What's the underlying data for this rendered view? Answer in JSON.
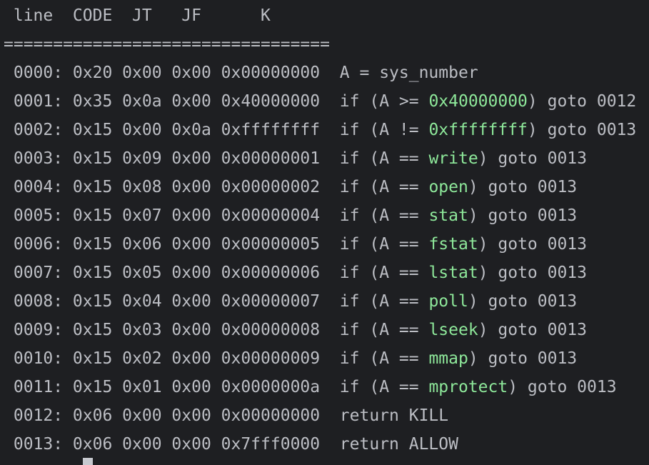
{
  "colors": {
    "background": "#1e1f22",
    "foreground": "#bcbec4",
    "highlight": "#8ee89a",
    "cursor": "#c7c9cf"
  },
  "header": " line  CODE  JT   JF      K",
  "separator": "=================================",
  "rows": [
    {
      "prefix": " 0000: 0x20 0x00 0x00 0x00000000  A = sys_number",
      "highlight": "",
      "suffix": ""
    },
    {
      "prefix": " 0001: 0x35 0x0a 0x00 0x40000000  if (A >= ",
      "highlight": "0x40000000",
      "suffix": ") goto 0012"
    },
    {
      "prefix": " 0002: 0x15 0x00 0x0a 0xffffffff  if (A != ",
      "highlight": "0xffffffff",
      "suffix": ") goto 0013"
    },
    {
      "prefix": " 0003: 0x15 0x09 0x00 0x00000001  if (A == ",
      "highlight": "write",
      "suffix": ") goto 0013"
    },
    {
      "prefix": " 0004: 0x15 0x08 0x00 0x00000002  if (A == ",
      "highlight": "open",
      "suffix": ") goto 0013"
    },
    {
      "prefix": " 0005: 0x15 0x07 0x00 0x00000004  if (A == ",
      "highlight": "stat",
      "suffix": ") goto 0013"
    },
    {
      "prefix": " 0006: 0x15 0x06 0x00 0x00000005  if (A == ",
      "highlight": "fstat",
      "suffix": ") goto 0013"
    },
    {
      "prefix": " 0007: 0x15 0x05 0x00 0x00000006  if (A == ",
      "highlight": "lstat",
      "suffix": ") goto 0013"
    },
    {
      "prefix": " 0008: 0x15 0x04 0x00 0x00000007  if (A == ",
      "highlight": "poll",
      "suffix": ") goto 0013"
    },
    {
      "prefix": " 0009: 0x15 0x03 0x00 0x00000008  if (A == ",
      "highlight": "lseek",
      "suffix": ") goto 0013"
    },
    {
      "prefix": " 0010: 0x15 0x02 0x00 0x00000009  if (A == ",
      "highlight": "mmap",
      "suffix": ") goto 0013"
    },
    {
      "prefix": " 0011: 0x15 0x01 0x00 0x0000000a  if (A == ",
      "highlight": "mprotect",
      "suffix": ") goto 0013"
    },
    {
      "prefix": " 0012: 0x06 0x00 0x00 0x00000000  return KILL",
      "highlight": "",
      "suffix": ""
    },
    {
      "prefix": " 0013: 0x06 0x00 0x00 0x7fff0000  return ALLOW",
      "highlight": "",
      "suffix": ""
    }
  ]
}
